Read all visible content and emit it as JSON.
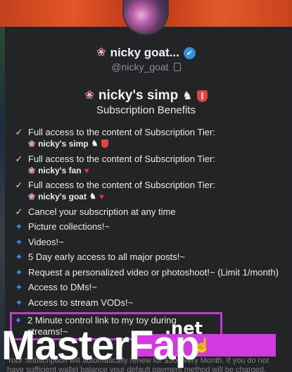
{
  "profile": {
    "display_name": "nicky goat...",
    "handle": "@nicky_goat",
    "flower_emoji": "🌸",
    "verified_color": "#2f8fe0"
  },
  "tier": {
    "title": "nicky's simp",
    "benefits_heading": "Subscription Benefits"
  },
  "benefits": [
    {
      "icon": "check-icon",
      "text": "Full access to the content of Subscription Tier:",
      "sub": "nicky's simp",
      "sub_icons": [
        "goat-icon",
        "shield-icon"
      ]
    },
    {
      "icon": "check-icon",
      "text": "Full access to the content of Subscription Tier:",
      "sub": "nicky's fan",
      "sub_icons": [
        "heart-icon"
      ]
    },
    {
      "icon": "check-icon",
      "text": "Full access to the content of Subscription Tier:",
      "sub": "nicky's goat",
      "sub_icons": [
        "goat-icon",
        "heart-icon"
      ]
    },
    {
      "icon": "check-icon",
      "text": "Cancel your subscription at any time"
    },
    {
      "icon": "star-icon",
      "text": "Picture collections!~"
    },
    {
      "icon": "star-icon",
      "text": "Videos!~"
    },
    {
      "icon": "star-icon",
      "text": "5 Day early access to all major posts!~"
    },
    {
      "icon": "star-icon",
      "text": "Request a personalized video or photoshoot!~ (Limit 1/month)"
    },
    {
      "icon": "star-icon",
      "text": "Access to DMs!~"
    },
    {
      "icon": "star-icon",
      "text": "Access to stream VODs!~"
    },
    {
      "icon": "star-icon",
      "text": "2 Minute control link to my toy during streams!~",
      "highlighted": true
    }
  ],
  "footer": {
    "text": "Your Subscription will automatically renew for $30 every Month. If you do not have sufficient wallet balance your default payment method will be charged."
  },
  "watermark": {
    "brand": "MasterFap",
    "suffix": ".net",
    "color": "#d23ae0"
  }
}
